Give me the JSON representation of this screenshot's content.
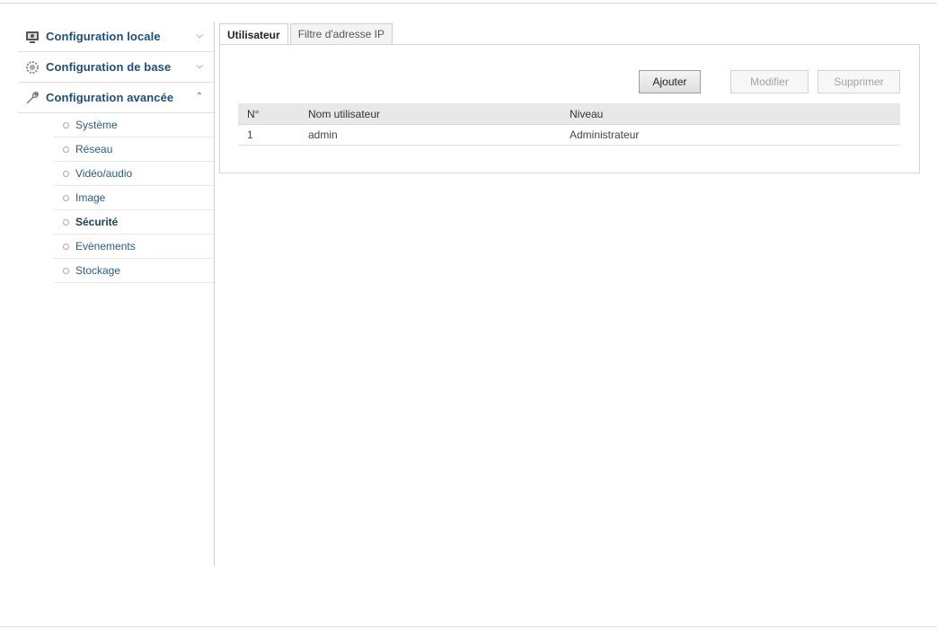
{
  "sidebar": {
    "sections": [
      {
        "label": "Configuration locale",
        "icon": "monitor-icon",
        "arrow": "⌄"
      },
      {
        "label": "Configuration de base",
        "icon": "gear-icon",
        "arrow": "⌄"
      },
      {
        "label": "Configuration avancée",
        "icon": "wrench-icon",
        "arrow": "⌃"
      }
    ],
    "subitems": [
      {
        "label": "Système"
      },
      {
        "label": "Réseau"
      },
      {
        "label": "Vidéo/audio"
      },
      {
        "label": "Image"
      },
      {
        "label": "Sécurité",
        "active": true
      },
      {
        "label": "Evènements"
      },
      {
        "label": "Stockage"
      }
    ]
  },
  "tabs": [
    {
      "label": "Utilisateur",
      "active": true
    },
    {
      "label": "Filtre d'adresse IP"
    }
  ],
  "toolbar": {
    "add_label": "Ajouter",
    "edit_label": "Modifier",
    "delete_label": "Supprimer"
  },
  "table": {
    "columns": [
      "N°",
      "Nom utilisateur",
      "Niveau"
    ],
    "rows": [
      [
        "1",
        "admin",
        "Administrateur"
      ]
    ]
  }
}
